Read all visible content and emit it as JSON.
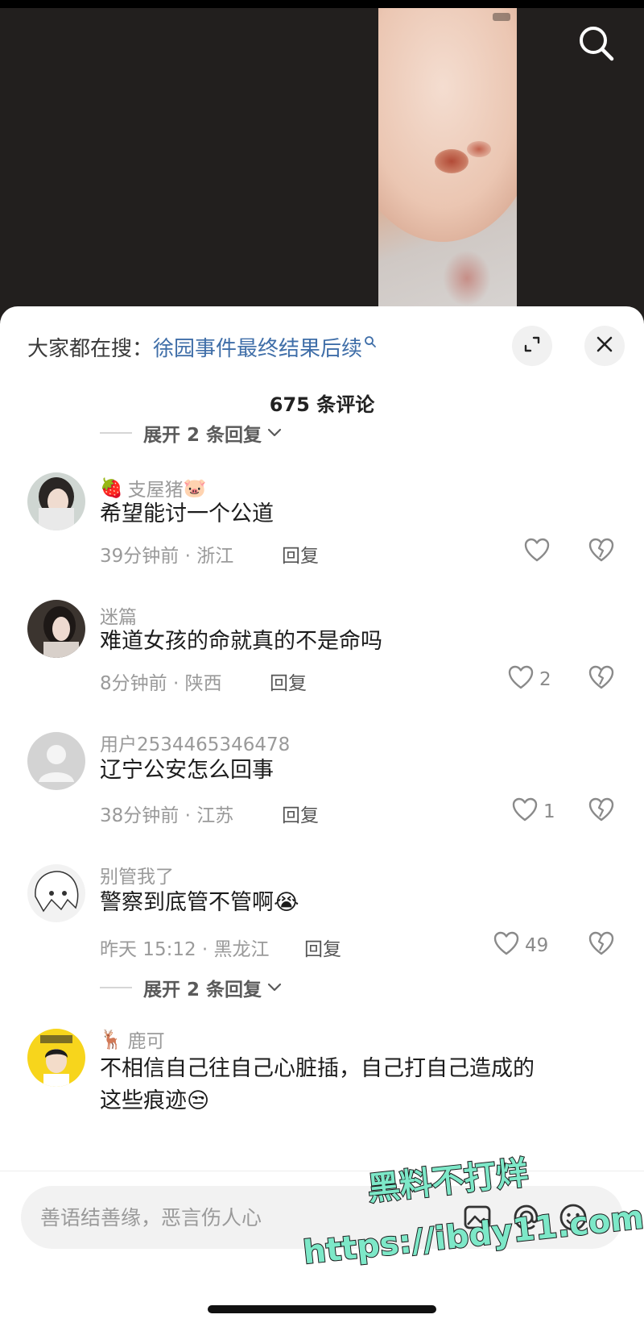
{
  "hot_search": {
    "prefix": "大家都在搜：",
    "query": "徐园事件最终结果后续"
  },
  "comments_header": {
    "count_label": "675 条评论"
  },
  "expand_replies_top": {
    "label": "展开 2 条回复"
  },
  "comments": [
    {
      "user_emoji_before": "🍓",
      "username": "支屋猪",
      "user_emoji_after": "🐷",
      "text": "希望能讨一个公道",
      "meta": "39分钟前 · 浙江",
      "reply_label": "回复",
      "likes": ""
    },
    {
      "user_emoji_before": "",
      "username": "迷篇",
      "user_emoji_after": "",
      "text": "难道女孩的命就真的不是命吗",
      "meta": "8分钟前 · 陕西",
      "reply_label": "回复",
      "likes": "2"
    },
    {
      "user_emoji_before": "",
      "username": "用户2534465346478",
      "user_emoji_after": "",
      "text": "辽宁公安怎么回事",
      "meta": "38分钟前 · 江苏",
      "reply_label": "回复",
      "likes": "1"
    },
    {
      "user_emoji_before": "",
      "username": "别管我了",
      "user_emoji_after": "",
      "text": "警察到底管不管啊😭",
      "meta": "昨天 15:12 · 黑龙江",
      "reply_label": "回复",
      "likes": "49"
    },
    {
      "user_emoji_before": "🦌",
      "username": "鹿可",
      "user_emoji_after": "",
      "text": "不相信自己往自己心脏插，自己打自己造成的",
      "text_line2": "这些痕迹😒",
      "meta": "",
      "reply_label": "",
      "likes": ""
    }
  ],
  "expand_replies_bottom": {
    "label": "展开 2 条回复"
  },
  "input": {
    "placeholder": "善语结善缘，恶言伤人心"
  },
  "watermark": {
    "line1": "黑料不打烊",
    "line2": "https://ibdy11.com",
    "color": "#7de8c8"
  },
  "icons": {
    "top_search": "search-icon",
    "expand": "expand-icon",
    "close": "close-icon",
    "like": "heart-icon",
    "dislike": "broken-heart-icon",
    "at": "at-icon",
    "emoji": "emoji-icon"
  }
}
